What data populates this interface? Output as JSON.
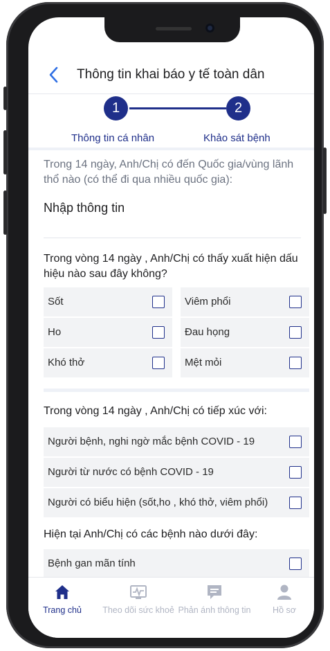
{
  "header": {
    "title": "Thông tin khai báo y tế toàn dân"
  },
  "stepper": {
    "steps": [
      {
        "number": "1",
        "label": "Thông tin cá nhân"
      },
      {
        "number": "2",
        "label": "Khảo sát bệnh"
      }
    ]
  },
  "form": {
    "countries_note": "Trong 14 ngày, Anh/Chị có đến Quốc gia/vùng lãnh thổ nào (có thể đi qua nhiều quốc gia):",
    "countries_placeholder": "Nhập thông tin",
    "symptoms_question": "Trong vòng 14 ngày , Anh/Chị có thấy xuất hiện dấu hiệu nào sau đây không?",
    "symptoms": [
      "Sốt",
      "Viêm phổi",
      "Ho",
      "Đau họng",
      "Khó thở",
      "Mệt mỏi"
    ],
    "contact_question": "Trong vòng 14 ngày , Anh/Chị có tiếp xúc với:",
    "contacts": [
      "Người bệnh, nghi ngờ mắc bệnh COVID - 19",
      "Người từ nước có bệnh COVID - 19",
      "Người có biểu hiện (sốt,ho , khó thở, viêm phổi)"
    ],
    "disease_question": "Hiện tại Anh/Chị có các bệnh nào dưới đây:",
    "diseases": [
      "Bệnh gan mãn tính"
    ]
  },
  "tabbar": {
    "items": [
      {
        "label": "Trang chủ",
        "icon": "home-icon",
        "active": true
      },
      {
        "label": "Theo dõi sức khoẻ",
        "icon": "health-monitor-icon",
        "active": false
      },
      {
        "label": "Phản ánh thông tin",
        "icon": "chat-icon",
        "active": false
      },
      {
        "label": "Hồ sơ",
        "icon": "profile-icon",
        "active": false
      }
    ]
  },
  "colors": {
    "primary": "#1f2f8a",
    "inactive": "#b0b5c3",
    "cell_bg": "#f2f3f5"
  }
}
